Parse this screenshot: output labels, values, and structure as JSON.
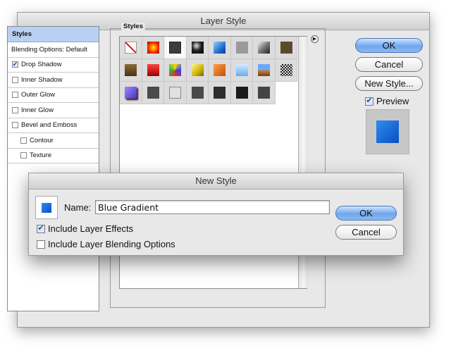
{
  "window": {
    "title": "Layer Style"
  },
  "styles_list": {
    "items": [
      {
        "label": "Styles",
        "selected": true
      },
      {
        "label": "Blending Options: Default"
      },
      {
        "label": "Drop Shadow",
        "checked": true
      },
      {
        "label": "Inner Shadow",
        "checked": false
      },
      {
        "label": "Outer Glow",
        "checked": false
      },
      {
        "label": "Inner Glow",
        "checked": false
      },
      {
        "label": "Bevel and Emboss",
        "checked": false
      },
      {
        "label": "Contour",
        "checked": false
      },
      {
        "label": "Texture",
        "checked": false
      }
    ]
  },
  "styles_panel": {
    "label": "Styles"
  },
  "buttons": {
    "ok": "OK",
    "cancel": "Cancel",
    "new_style": "New Style..."
  },
  "preview": {
    "label": "Preview",
    "checked": true,
    "accent": "#1565d8"
  },
  "new_style_dialog": {
    "title": "New Style",
    "name_label": "Name:",
    "name_value": "Blue Gradient",
    "include_effects_label": "Include Layer Effects",
    "include_effects_checked": true,
    "include_blending_label": "Include Layer Blending Options",
    "include_blending_checked": false,
    "ok": "OK",
    "cancel": "Cancel"
  },
  "check_glyph": "✔",
  "menu_glyph": "▶"
}
